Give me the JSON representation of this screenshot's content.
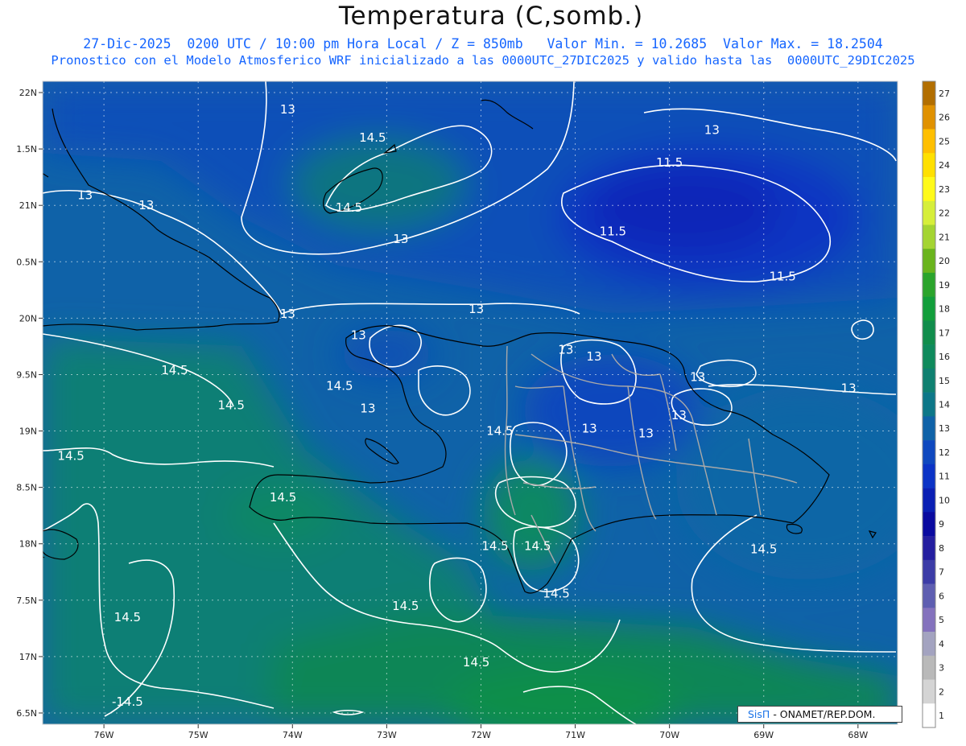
{
  "header": {
    "title": "Temperatura (C,somb.)",
    "subtitle_line1": "27-Dic-2025  0200 UTC / 10:00 pm Hora Local / Z = 850mb   Valor Min. = 10.2685  Valor Max. = 18.2504",
    "subtitle_line2": "Pronostico con el Modelo Atmosferico WRF inicializado a las 0000UTC_27DIC2025 y valido hasta las  0000UTC_29DIC2025"
  },
  "map": {
    "lat_labels": [
      "22N",
      "1.5N",
      "21N",
      "0.5N",
      "20N",
      "9.5N",
      "19N",
      "8.5N",
      "18N",
      "7.5N",
      "17N",
      "6.5N"
    ],
    "lon_labels": [
      "76W",
      "75W",
      "74W",
      "73W",
      "72W",
      "71W",
      "70W",
      "69W",
      "68W"
    ],
    "contour_labels": [
      {
        "text": "13",
        "lon": -74.05,
        "lat": 21.85
      },
      {
        "text": "14.5",
        "lon": -73.15,
        "lat": 21.6
      },
      {
        "text": "13",
        "lon": -69.55,
        "lat": 21.67
      },
      {
        "text": "11.5",
        "lon": -70.0,
        "lat": 21.38
      },
      {
        "text": "13",
        "lon": -76.2,
        "lat": 21.09
      },
      {
        "text": "13",
        "lon": -75.55,
        "lat": 21.0
      },
      {
        "text": "14.5",
        "lon": -73.4,
        "lat": 20.98
      },
      {
        "text": "11.5",
        "lon": -70.6,
        "lat": 20.77
      },
      {
        "text": "13",
        "lon": -72.85,
        "lat": 20.7
      },
      {
        "text": "11.5",
        "lon": -68.8,
        "lat": 20.37
      },
      {
        "text": "13",
        "lon": -72.05,
        "lat": 20.08
      },
      {
        "text": "13",
        "lon": -74.05,
        "lat": 20.04
      },
      {
        "text": "13",
        "lon": -73.3,
        "lat": 19.85
      },
      {
        "text": "13",
        "lon": -71.1,
        "lat": 19.72
      },
      {
        "text": "13",
        "lon": -70.8,
        "lat": 19.66
      },
      {
        "text": "14.5",
        "lon": -75.25,
        "lat": 19.54
      },
      {
        "text": "13",
        "lon": -69.7,
        "lat": 19.48
      },
      {
        "text": "14.5",
        "lon": -73.5,
        "lat": 19.4
      },
      {
        "text": "13",
        "lon": -68.1,
        "lat": 19.38
      },
      {
        "text": "14.5",
        "lon": -74.65,
        "lat": 19.23
      },
      {
        "text": "13",
        "lon": -73.2,
        "lat": 19.2
      },
      {
        "text": "13",
        "lon": -69.9,
        "lat": 19.14
      },
      {
        "text": "14.5",
        "lon": -71.8,
        "lat": 19.0
      },
      {
        "text": "13",
        "lon": -70.85,
        "lat": 19.02
      },
      {
        "text": "13",
        "lon": -70.25,
        "lat": 18.98
      },
      {
        "text": "14.5",
        "lon": -76.35,
        "lat": 18.78
      },
      {
        "text": "14.5",
        "lon": -74.1,
        "lat": 18.41
      },
      {
        "text": "14.5",
        "lon": -71.85,
        "lat": 17.98
      },
      {
        "text": "14.5",
        "lon": -71.4,
        "lat": 17.98
      },
      {
        "text": "14.5",
        "lon": -69.0,
        "lat": 17.95
      },
      {
        "text": "14.5",
        "lon": -71.2,
        "lat": 17.56
      },
      {
        "text": "14.5",
        "lon": -72.8,
        "lat": 17.45
      },
      {
        "text": "14.5",
        "lon": -75.75,
        "lat": 17.35
      },
      {
        "text": "14.5",
        "lon": -72.05,
        "lat": 16.95
      },
      {
        "text": "-14.5",
        "lon": -75.75,
        "lat": 16.6
      }
    ]
  },
  "colorbar": {
    "labels": [
      "27",
      "26",
      "25",
      "24",
      "23",
      "22",
      "21",
      "20",
      "19",
      "18",
      "17",
      "16",
      "15",
      "14",
      "13",
      "12",
      "11",
      "10",
      "9",
      "8",
      "7",
      "6",
      "5",
      "4",
      "3",
      "2",
      "1"
    ],
    "colors": [
      "#b26e00",
      "#e09100",
      "#ffbf00",
      "#ffe000",
      "#fffa1a",
      "#d6ee3a",
      "#a4d432",
      "#6ab41d",
      "#2ba42c",
      "#129e3b",
      "#118d4c",
      "#0f8a5c",
      "#0f8070",
      "#0d7788",
      "#0f62a8",
      "#0f48bf",
      "#0b33c6",
      "#0a1fb4",
      "#0a0aa0",
      "#241ea0",
      "#3c3ca7",
      "#5e5eb1",
      "#8472bd",
      "#a3a3c0",
      "#b9b9b9",
      "#d4d4d4",
      "#ffffff"
    ]
  },
  "footer": {
    "credit_sis": "SisΠ",
    "credit_rest": "- ONAMET/REP.DOM."
  }
}
